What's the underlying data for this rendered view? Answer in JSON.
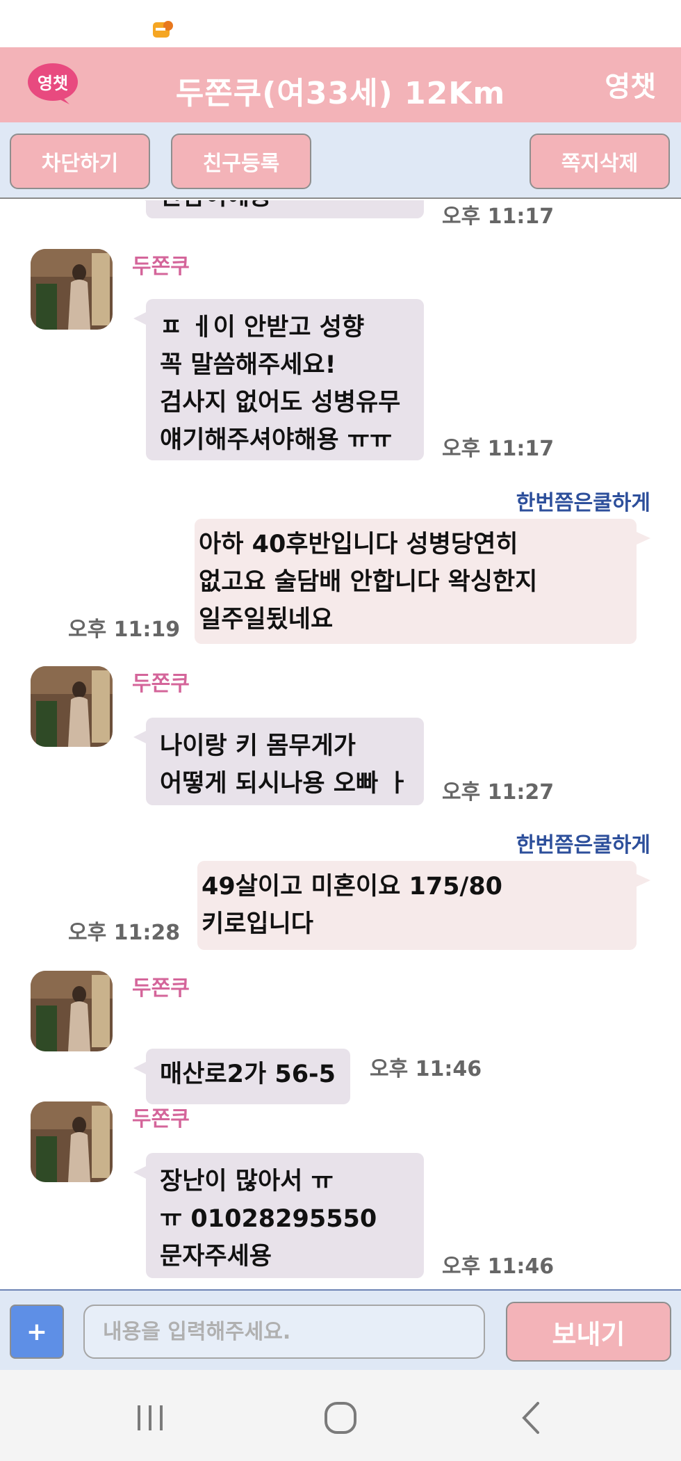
{
  "header": {
    "title": "두쫀쿠(여33세) 12Km",
    "logo_text": "영챗",
    "right_label": "영챗"
  },
  "toolbar": {
    "block_label": "차단하기",
    "friend_label": "친구등록",
    "delete_label": "쪽지삭제"
  },
  "messages": [
    {
      "type": "in",
      "sender": "",
      "lines": [
        "만남이예용"
      ],
      "time": "오후 11:17"
    },
    {
      "type": "in",
      "sender": "두쫀쿠",
      "lines": [
        "ㅍ ㅔ이 안받고 성향",
        "꼭 말씀해주세요!",
        "검사지 없어도 성병유무",
        "얘기해주셔야해용 ㅠㅠ"
      ],
      "time": "오후 11:17"
    },
    {
      "type": "out",
      "sender": "한번쯤은쿨하게",
      "lines": [
        "아하 40후반입니다 성병당연히",
        "없고요 술담배 안합니다 왁싱한지",
        "일주일됬네요"
      ],
      "time": "오후 11:19"
    },
    {
      "type": "in",
      "sender": "두쫀쿠",
      "lines": [
        "나이랑 키 몸무게가",
        "어떻게 되시나용 오빠 ㅏ"
      ],
      "time": "오후 11:27"
    },
    {
      "type": "out",
      "sender": "한번쯤은쿨하게",
      "lines": [
        "49살이고 미혼이요 175/80",
        "키로입니다"
      ],
      "time": "오후 11:28"
    },
    {
      "type": "in",
      "sender": "두쫀쿠",
      "lines": [
        "매산로2가 56-5"
      ],
      "time": "오후 11:46"
    },
    {
      "type": "in",
      "sender": "두쫀쿠",
      "lines": [
        "장난이 많아서 ㅠ",
        "ㅠ 01028295550",
        "문자주세용"
      ],
      "time": "오후 11:46"
    }
  ],
  "input": {
    "plus_label": "+",
    "placeholder": "내용을 입력해주세요.",
    "send_label": "보내기"
  },
  "colors": {
    "header_pink": "#f3b3b8",
    "toolbar_blue": "#dfe8f5",
    "sender_pink": "#d4659a",
    "self_name_blue": "#2d4f9b",
    "bubble_in": "#e8e2ea",
    "bubble_out": "#f6eaea"
  },
  "icons": {
    "status": "notification-app-icon",
    "nav": [
      "recent-apps-icon",
      "home-icon",
      "back-icon"
    ]
  }
}
